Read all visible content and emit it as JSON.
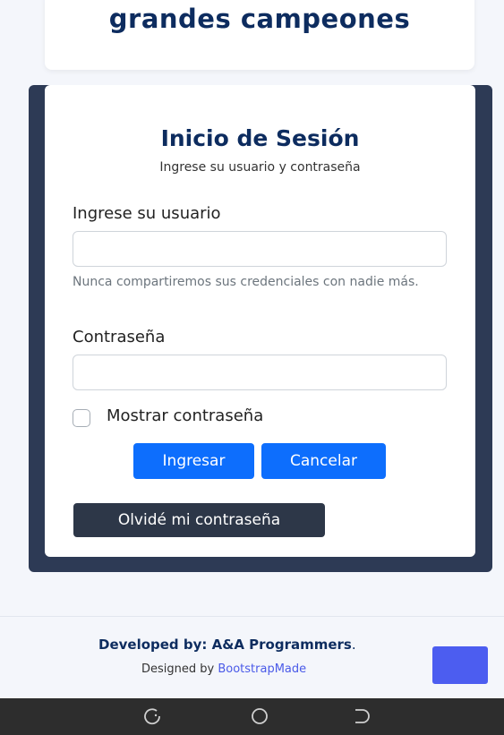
{
  "hero": {
    "title": "grandes campeones"
  },
  "login": {
    "title": "Inicio de Sesión",
    "subtitle": "Ingrese su usuario y contraseña",
    "user_label": "Ingrese su usuario",
    "user_value": "",
    "user_help": "Nunca compartiremos sus credenciales con nadie más.",
    "password_label": "Contraseña",
    "password_value": "",
    "show_password_label": "Mostrar contraseña",
    "show_password_checked": false,
    "submit_label": "Ingresar",
    "cancel_label": "Cancelar",
    "forgot_label": "Olvidé mi contraseña"
  },
  "footer": {
    "developed_by": "Developed by: A&A Programmers",
    "developed_suffix": ".",
    "designed_prefix": "Designed by",
    "designed_link": "BootstrapMade"
  },
  "navbar": {
    "icons": [
      "recent-apps-icon",
      "home-icon",
      "back-icon"
    ]
  },
  "colors": {
    "primary": "#0d6efd",
    "dark": "#2d3748",
    "heading": "#0d2c5f",
    "panel": "#2d3a55",
    "back_to_top": "#4c5df0"
  }
}
